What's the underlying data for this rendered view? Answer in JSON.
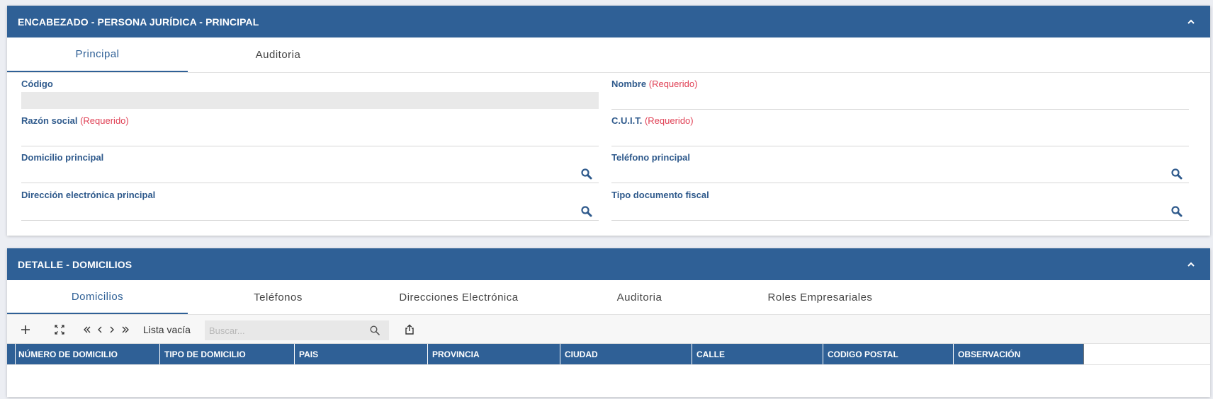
{
  "header_panel": {
    "title": "ENCABEZADO - PERSONA JURÍDICA - PRINCIPAL",
    "tabs": [
      {
        "label": "Principal",
        "active": true
      },
      {
        "label": "Auditoria",
        "active": false
      }
    ],
    "fields": {
      "codigo": {
        "label": "Código",
        "required": ""
      },
      "nombre": {
        "label": "Nombre",
        "required": "(Requerido)"
      },
      "razon_social": {
        "label": "Razón social",
        "required": "(Requerido)"
      },
      "cuit": {
        "label": "C.U.I.T.",
        "required": "(Requerido)"
      },
      "domicilio": {
        "label": "Domicilio principal",
        "required": ""
      },
      "telefono": {
        "label": "Teléfono principal",
        "required": ""
      },
      "direccion_electronica": {
        "label": "Dirección electrónica principal",
        "required": ""
      },
      "tipo_documento": {
        "label": "Tipo documento fiscal",
        "required": ""
      }
    }
  },
  "detail_panel": {
    "title": "DETALLE - DOMICILIOS",
    "tabs": [
      {
        "label": "Domicilios",
        "active": true
      },
      {
        "label": "Teléfonos",
        "active": false
      },
      {
        "label": "Direcciones Electrónica",
        "active": false
      },
      {
        "label": "Auditoria",
        "active": false
      },
      {
        "label": "Roles Empresariales",
        "active": false
      }
    ],
    "toolbar": {
      "list_status": "Lista vacía",
      "search_placeholder": "Buscar..."
    },
    "columns": [
      "NÚMERO DE DOMICILIO",
      "TIPO DE DOMICILIO",
      "PAIS",
      "PROVINCIA",
      "CIUDAD",
      "CALLE",
      "CODIGO POSTAL",
      "OBSERVACIÓN"
    ]
  },
  "colors": {
    "primary": "#2f6096",
    "label": "#2f5a8c",
    "required": "#e04155"
  }
}
